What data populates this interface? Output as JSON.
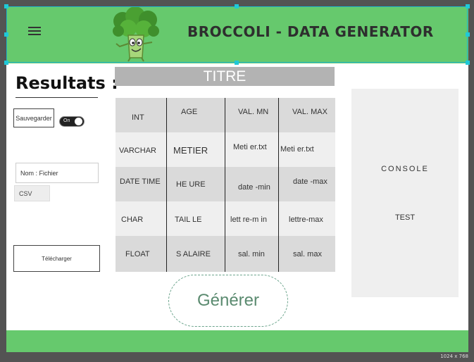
{
  "header": {
    "title": "BROCCOLI - DATA GENERATOR",
    "menu_icon": "hamburger-menu-icon",
    "logo_icon": "broccoli-mascot-icon"
  },
  "sidebar": {
    "section_title": "Resultats :",
    "save_label": "Sauvegarder",
    "toggle_label": "On",
    "filename_placeholder": "Nom : Fichier",
    "format": "CSV",
    "download_label": "Télécharger"
  },
  "table": {
    "title": "TITRE",
    "rows": [
      [
        "INT",
        "AGE",
        "VAL. MN",
        "VAL. MAX"
      ],
      [
        "VARCHAR",
        "METIER",
        "Meti er.txt",
        "Meti er.txt"
      ],
      [
        "DATE TIME",
        "HE URE",
        "date -min",
        "date -max"
      ],
      [
        "CHAR",
        "TAIL LE",
        "lett re-m in",
        "lettre-max"
      ],
      [
        "FLOAT",
        "S ALAIRE",
        "sal. min",
        "sal. max"
      ]
    ]
  },
  "generate_label": "Générer",
  "console": {
    "title": "CONSOLE",
    "text": "TEST"
  },
  "canvas_size_label": "1024 x 768",
  "colors": {
    "header_green": "#66c96d",
    "row_dark": "#dadada",
    "row_light": "#efefef",
    "selection": "#1fc8d8"
  }
}
